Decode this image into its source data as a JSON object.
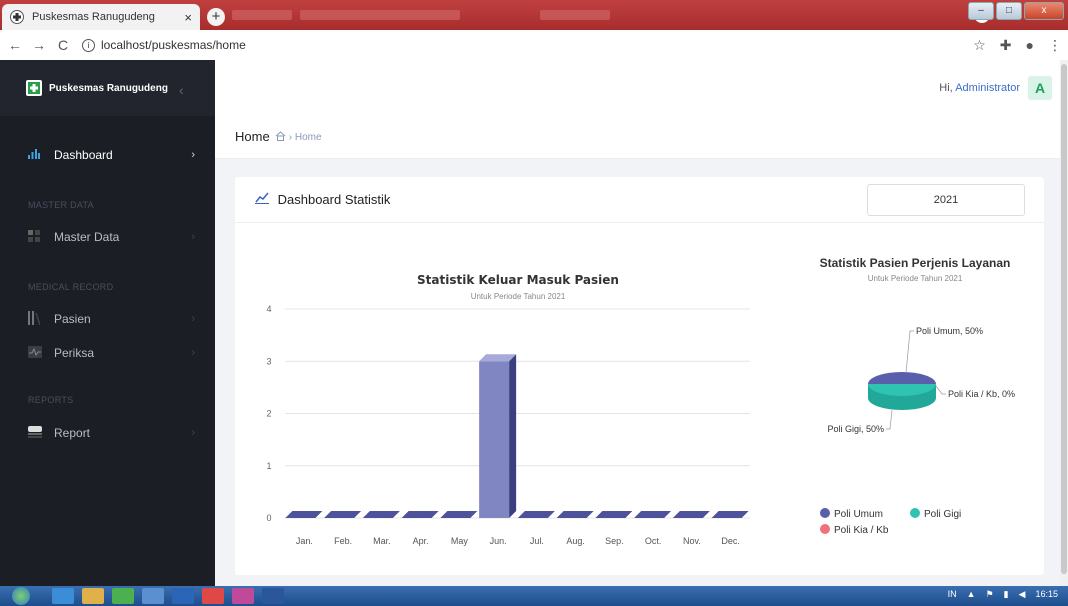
{
  "browser": {
    "tab_title": "Puskesmas Ranugudeng",
    "tab_close": "×",
    "new_tab": "+",
    "url": "localhost/puskesmas/home",
    "back": "←",
    "forward": "→",
    "reload": "C",
    "star": "☆",
    "ext": "✚",
    "profile": "●",
    "menu": "⋮",
    "win_min": "–",
    "win_max": "□",
    "win_close": "x"
  },
  "sidebar": {
    "brand": "Puskesmas Ranugudeng",
    "collapse": "‹",
    "items": [
      {
        "label": "Dashboard",
        "icon": "bar-chart-icon",
        "chev": "›"
      },
      {
        "label": "Master Data",
        "icon": "grid-icon",
        "chev": "›"
      },
      {
        "label": "Pasien",
        "icon": "pasien-icon",
        "chev": "›"
      },
      {
        "label": "Periksa",
        "icon": "pulse-icon",
        "chev": "›"
      },
      {
        "label": "Report",
        "icon": "report-icon",
        "chev": "›"
      }
    ],
    "sections": [
      "MASTER DATA",
      "MEDICAL RECORD",
      "REPORTS"
    ]
  },
  "header": {
    "greeting": "Hi,",
    "user": "Administrator",
    "avatar": "A"
  },
  "breadcrumb": {
    "title": "Home",
    "trail": "Home"
  },
  "card": {
    "title": "Dashboard Statistik",
    "year": "2021"
  },
  "chart_data": [
    {
      "type": "bar",
      "title": "Statistik Keluar Masuk Pasien",
      "subtitle": "Untuk Periode Tahun 2021",
      "categories": [
        "Jan.",
        "Feb.",
        "Mar.",
        "Apr.",
        "May",
        "Jun.",
        "Jul.",
        "Aug.",
        "Sep.",
        "Oct.",
        "Nov.",
        "Dec."
      ],
      "values": [
        0,
        0,
        0,
        0,
        0,
        3,
        0,
        0,
        0,
        0,
        0,
        0
      ],
      "ylim": [
        0,
        4
      ],
      "yticks": [
        0,
        1,
        2,
        3,
        4
      ],
      "grid": true,
      "color": "#6a6fb2"
    },
    {
      "type": "pie",
      "title": "Statistik Pasien Perjenis Layanan",
      "subtitle": "Untuk Periode Tahun 2021",
      "slices": [
        {
          "name": "Poli Umum",
          "value": 50,
          "label": "Poli Umum, 50%",
          "color": "#5a5fab"
        },
        {
          "name": "Poli Gigi",
          "value": 50,
          "label": "Poli Gigi, 50%",
          "color": "#2fc4b2"
        },
        {
          "name": "Poli Kia / Kb",
          "value": 0,
          "label": "Poli Kia / Kb, 0%",
          "color": "#f0727a"
        }
      ],
      "legend": "bottom"
    }
  ],
  "taskbar": {
    "lang": "IN",
    "time": "16:15"
  }
}
